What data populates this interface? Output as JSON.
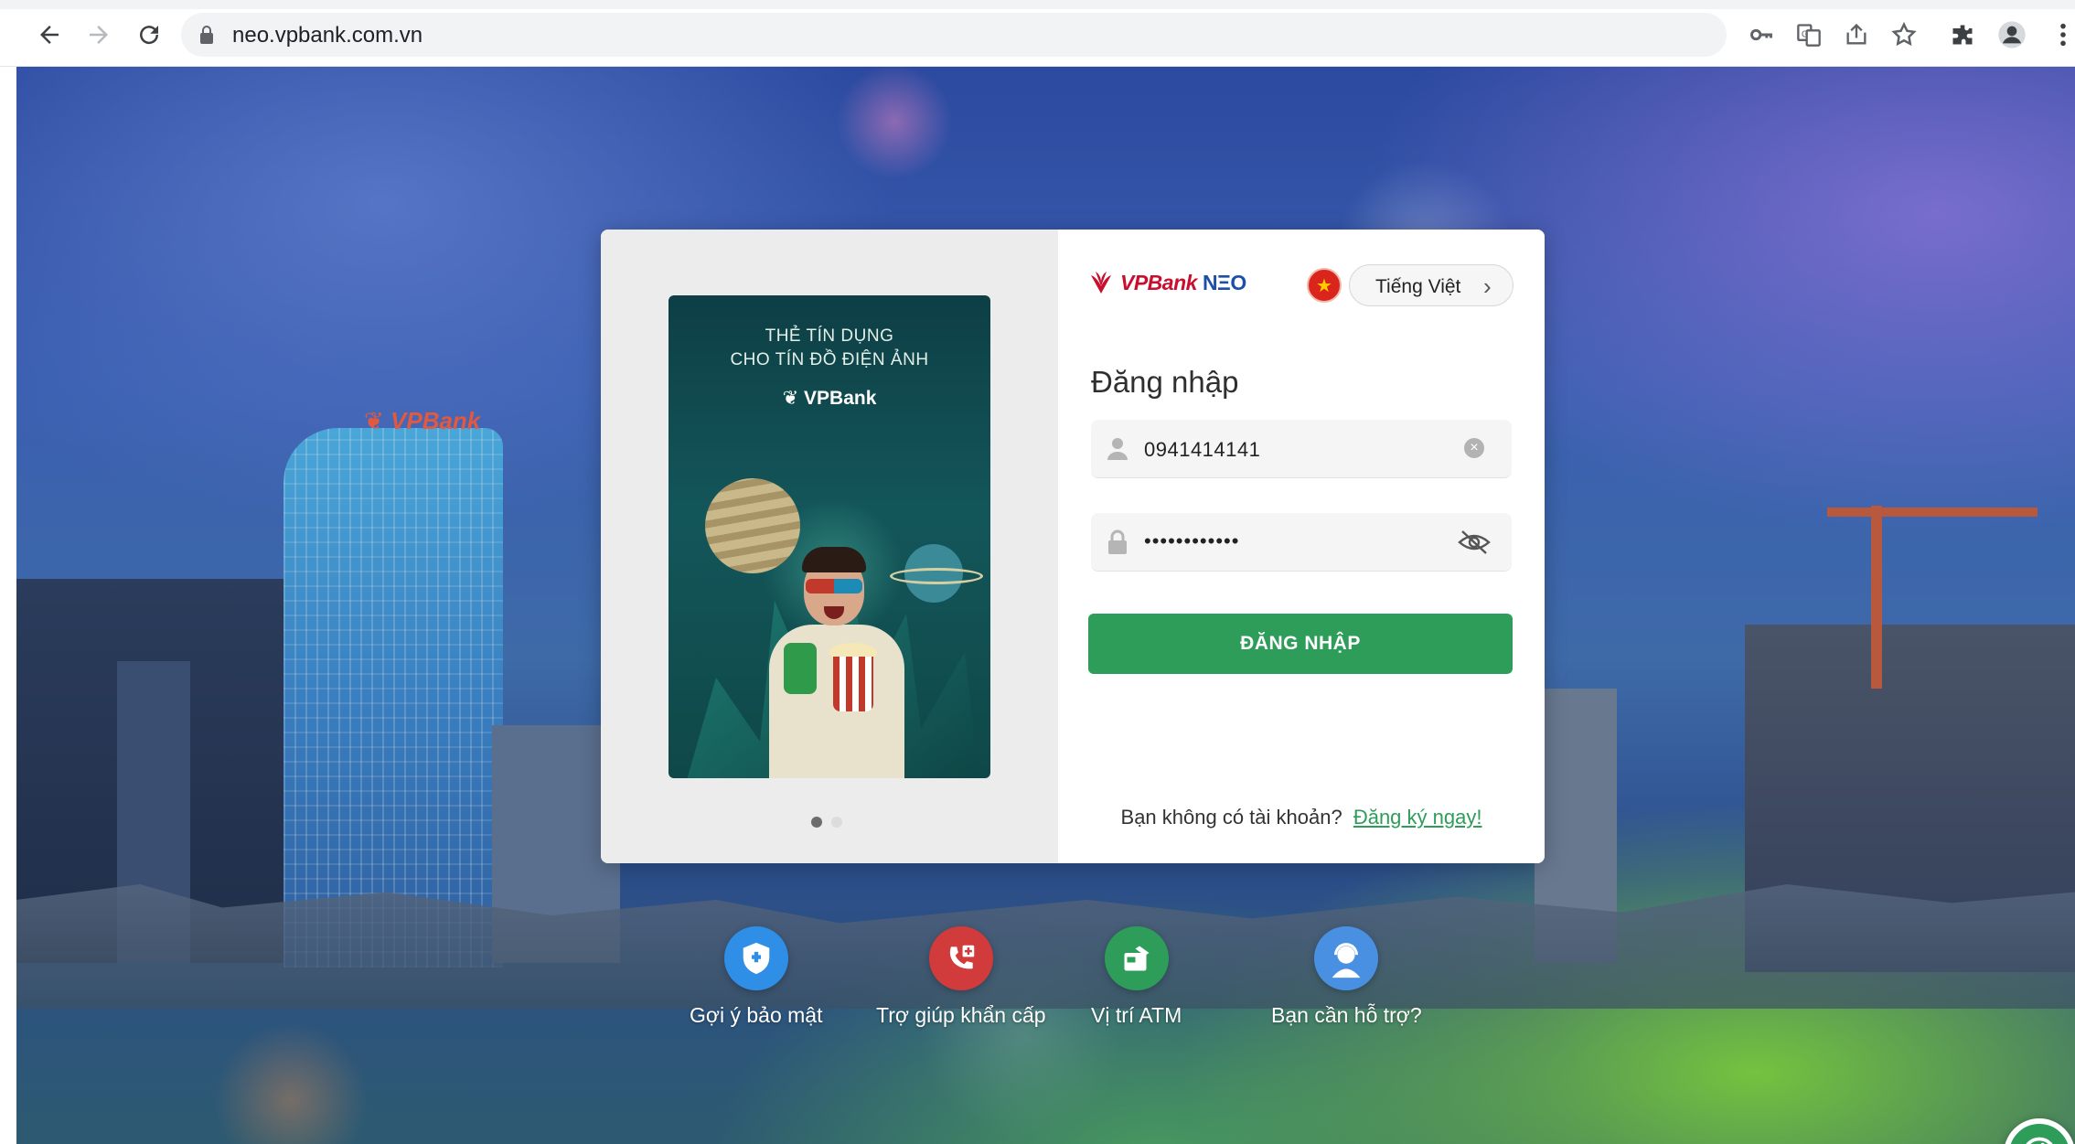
{
  "browser": {
    "url": "neo.vpbank.com.vn",
    "icons": [
      "back-icon",
      "forward-icon",
      "reload-icon",
      "lock-icon",
      "key-icon",
      "translate-icon",
      "share-icon",
      "bookmark-star-icon",
      "extensions-icon",
      "profile-icon",
      "menu-icon"
    ]
  },
  "promo": {
    "title_line1": "THẺ TÍN DỤNG",
    "title_line2": "CHO TÍN ĐỒ ĐIỆN ẢNH",
    "brand": "VPBank",
    "slides_total": 2,
    "active_slide": 1
  },
  "login": {
    "logo_vp": "VPBank",
    "logo_neo": "NΞO",
    "language_label": "Tiếng Việt",
    "title": "Đăng nhập",
    "username_value": "0941414141",
    "password_mask": "••••••••••••",
    "submit_label": "ĐĂNG NHẬP",
    "no_account_text": "Bạn không có tài khoản?",
    "signup_link": "Đăng ký ngay!"
  },
  "quick_links": [
    {
      "label": "Gợi ý bảo mật",
      "icon": "shield-icon",
      "color": "#2f8ee5"
    },
    {
      "label": "Trợ giúp khẩn cấp",
      "icon": "emergency-call-icon",
      "color": "#d23b3b"
    },
    {
      "label": "Vị trí ATM",
      "icon": "atm-icon",
      "color": "#2e9d5a"
    },
    {
      "label": "Bạn cần hỗ trợ?",
      "icon": "support-agent-icon",
      "color": "#4a90e2"
    }
  ],
  "colors": {
    "primary_green": "#2e9d5a",
    "brand_red": "#c8102e",
    "brand_blue": "#1e4fa8"
  }
}
